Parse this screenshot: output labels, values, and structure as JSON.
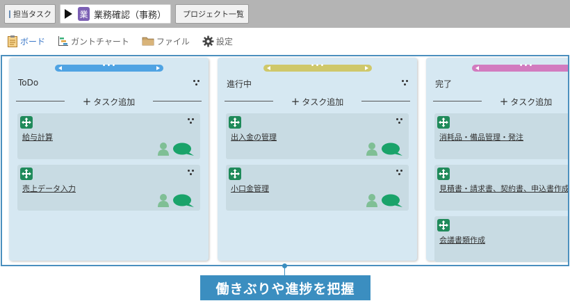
{
  "tabs": {
    "my_tasks": "担当タスク",
    "current_badge": "業",
    "current_title": "業務確認（事務）",
    "project_list": "プロジェクト一覧"
  },
  "toolbar": {
    "board": "ボード",
    "gantt": "ガントチャート",
    "files": "ファイル",
    "settings": "設定"
  },
  "columns": [
    {
      "title": "ToDo",
      "add_label": "タスク追加",
      "color": "#4fa3e3",
      "cards": [
        {
          "title": "給与計算"
        },
        {
          "title": "売上データ入力"
        }
      ]
    },
    {
      "title": "進行中",
      "add_label": "タスク追加",
      "color": "#cfc86a",
      "cards": [
        {
          "title": "出入金の管理"
        },
        {
          "title": "小口金管理"
        }
      ]
    },
    {
      "title": "完了",
      "add_label": "タスク追加",
      "color": "#d27bbf",
      "cards": [
        {
          "title": "消耗品・備品管理・発注"
        },
        {
          "title": "見積書・請求書、契約書、申込書作成"
        },
        {
          "title": "会議書類作成"
        }
      ]
    }
  ],
  "callout": "働きぶりや進捗を把握",
  "colors": {
    "accent": "#3b8ec0",
    "card_icon": "#1f8a5a",
    "chat": "#1aa36a",
    "user": "#7fbf95"
  }
}
